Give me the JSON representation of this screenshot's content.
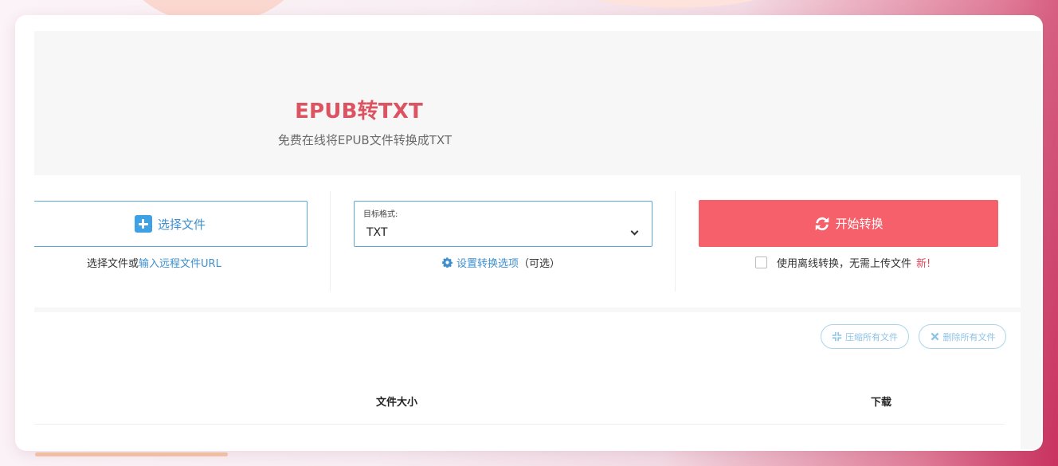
{
  "hero": {
    "title": "EPUB转TXT",
    "subtitle": "免费在线将EPUB文件转换成TXT"
  },
  "upload": {
    "choose_label": "选择文件",
    "hint_prefix": "选择文件或",
    "hint_link": "输入远程文件URL",
    "icon": "plus-icon"
  },
  "format": {
    "label": "目标格式:",
    "selected": "TXT",
    "options_link": "设置转换选项",
    "options_suffix": "（可选）",
    "icon": "gear-icon"
  },
  "convert": {
    "start_label": "开始转换",
    "offline_label": "使用离线转换，无需上传文件",
    "new_badge": "新!",
    "offline_checked": false,
    "icon": "refresh-icon"
  },
  "file_list": {
    "compress_label": "压缩所有文件",
    "delete_label": "删除所有文件",
    "columns": [
      "文件大小",
      "下载"
    ]
  },
  "colors": {
    "accent_red": "#f5606b",
    "title_red": "#dc5361",
    "link_blue": "#3e8fcf",
    "border_blue": "#5aa8d8"
  }
}
